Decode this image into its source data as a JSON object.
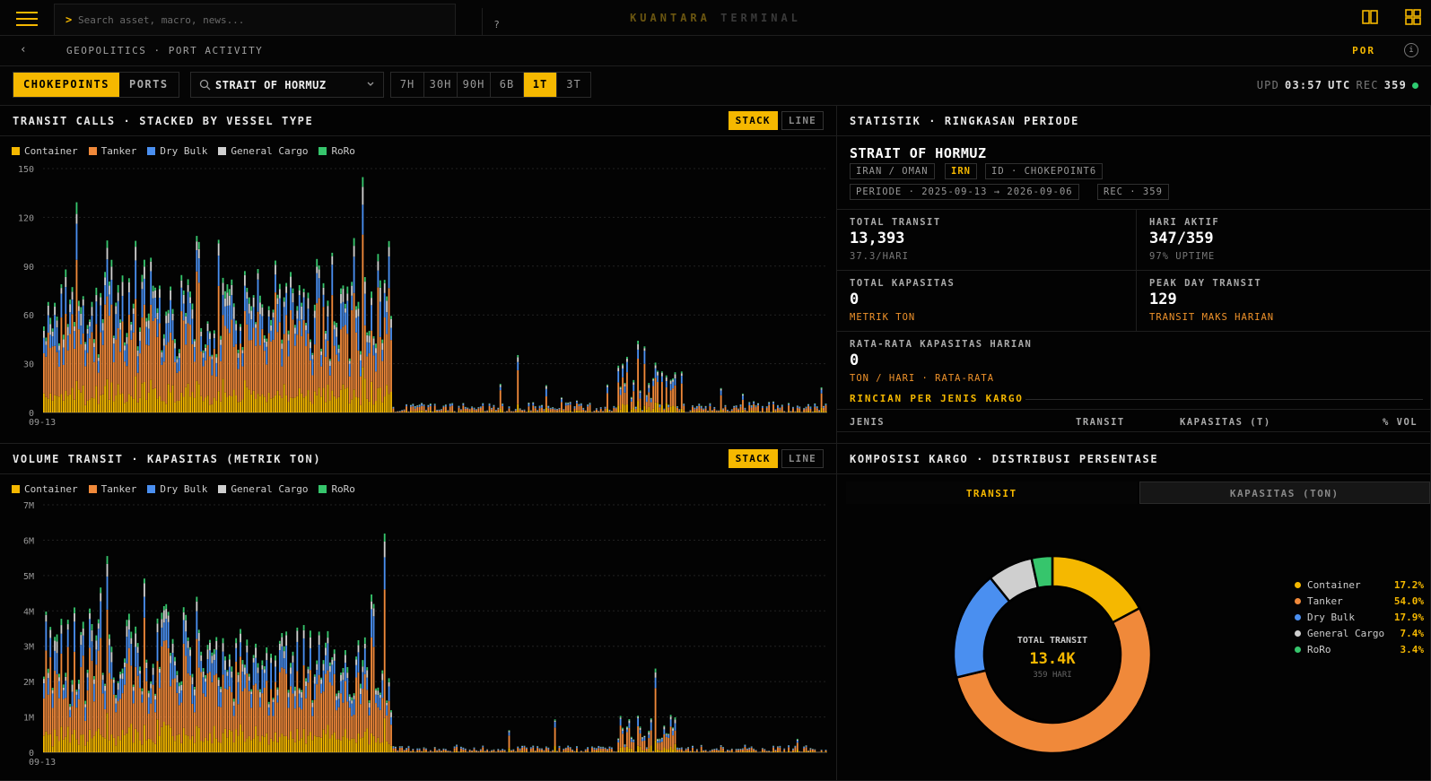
{
  "app": {
    "brand_a": "KUANTARA",
    "brand_b": "TERMINAL",
    "search_placeholder": "Search asset, macro, news...",
    "search_prompt": ">",
    "help": "?"
  },
  "breadcrumb": {
    "text": "GEOPOLITICS · PORT ACTIVITY",
    "back": "‹",
    "lang": "POR",
    "info": "i"
  },
  "toolbar": {
    "tab_chokepoints": "CHOKEPOINTS",
    "tab_ports": "PORTS",
    "selected": "STRAIT OF HORMUZ",
    "ranges": [
      "7H",
      "30H",
      "90H",
      "6B",
      "1T",
      "3T"
    ],
    "active_range": "1T",
    "upd_label": "UPD",
    "upd_time": "03:57",
    "upd_tz": "UTC",
    "rec_label": "REC",
    "rec_count": "359"
  },
  "colors": {
    "accent": "#f5b800",
    "container": "#f5b800",
    "tanker": "#f0893a",
    "drybulk": "#4a8ff0",
    "general": "#cfcfcf",
    "roro": "#36c56c"
  },
  "legend": [
    {
      "name": "Container",
      "color": "#f5b800"
    },
    {
      "name": "Tanker",
      "color": "#f0893a"
    },
    {
      "name": "Dry Bulk",
      "color": "#4a8ff0"
    },
    {
      "name": "General Cargo",
      "color": "#cfcfcf"
    },
    {
      "name": "RoRo",
      "color": "#36c56c"
    }
  ],
  "panel_transit": {
    "title": "TRANSIT CALLS · STACKED BY VESSEL TYPE",
    "stack": "STACK",
    "line": "LINE"
  },
  "panel_volume": {
    "title": "VOLUME TRANSIT · KAPASITAS (METRIK TON)",
    "stack": "STACK",
    "line": "LINE"
  },
  "chart_data": [
    {
      "type": "bar",
      "title": "TRANSIT CALLS · STACKED BY VESSEL TYPE",
      "stacked": true,
      "x_first_label": "09-13",
      "days": 359,
      "yticks": [
        "0",
        "30",
        "60",
        "90",
        "120",
        "150"
      ],
      "ylim": [
        0,
        150
      ],
      "grid": true,
      "series_names": [
        "Container",
        "Tanker",
        "Dry Bulk",
        "General Cargo",
        "RoRo"
      ],
      "profile": [
        {
          "from": 0,
          "to": 160,
          "total": 70,
          "shares": [
            0.17,
            0.54,
            0.18,
            0.07,
            0.04
          ]
        },
        {
          "from": 160,
          "to": 359,
          "total": 5,
          "shares": [
            0.15,
            0.45,
            0.3,
            0.07,
            0.03
          ]
        }
      ],
      "peaks": [
        {
          "day": 15,
          "value": 129
        },
        {
          "day": 146,
          "value": 126
        },
        {
          "day": 272,
          "value": 51
        },
        {
          "day": 217,
          "value": 39
        }
      ]
    },
    {
      "type": "bar",
      "title": "VOLUME TRANSIT · KAPASITAS (METRIK TON)",
      "stacked": true,
      "x_first_label": "09-13",
      "days": 359,
      "yticks": [
        "0",
        "1M",
        "2M",
        "3M",
        "4M",
        "5M",
        "6M",
        "7M"
      ],
      "ylim": [
        0,
        7000000
      ],
      "grid": true,
      "series_names": [
        "Container",
        "Tanker",
        "Dry Bulk",
        "General Cargo",
        "RoRo"
      ],
      "peaks": [
        {
          "day": 29,
          "value": 6200000
        },
        {
          "day": 156,
          "value": 5600000
        },
        {
          "day": 280,
          "value": 2300000
        }
      ]
    },
    {
      "type": "pie",
      "title": "KOMPOSISI KARGO · DISTRIBUSI PERSENTASE",
      "categories": [
        "Container",
        "Tanker",
        "Dry Bulk",
        "General Cargo",
        "RoRo"
      ],
      "values": [
        17.2,
        54.0,
        17.9,
        7.4,
        3.4
      ],
      "center_label": "TOTAL TRANSIT",
      "center_value": "13.4K",
      "center_sub": "359 HARI"
    }
  ],
  "stats": {
    "title": "STATISTIK · RINGKASAN PERIODE",
    "name": "STRAIT OF HORMUZ",
    "chip_country": "IRAN / OMAN",
    "chip_code": "IRN",
    "chip_id": "ID · CHOKEPOINT6",
    "chip_period": "PERIODE · 2025-09-13 → 2026-09-06",
    "chip_rec": "REC · 359",
    "total_transit_label": "TOTAL TRANSIT",
    "total_transit": "13,393",
    "total_transit_sub": "37.3/HARI",
    "hari_aktif_label": "HARI AKTIF",
    "hari_aktif": "347/359",
    "hari_aktif_sub": "97% UPTIME",
    "total_kap_label": "TOTAL KAPASITAS",
    "total_kap": "0",
    "total_kap_sub": "METRIK TON",
    "peak_label": "PEAK DAY TRANSIT",
    "peak": "129",
    "peak_sub": "TRANSIT MAKS HARIAN",
    "avg_label": "RATA-RATA KAPASITAS HARIAN",
    "avg": "0",
    "avg_sub": "TON / HARI · RATA-RATA",
    "breakdown": "RINCIAN PER JENIS KARGO",
    "th_jenis": "JENIS",
    "th_transit": "TRANSIT",
    "th_kap": "KAPASITAS (T)",
    "th_vol": "% VOL"
  },
  "donut": {
    "title": "KOMPOSISI KARGO · DISTRIBUSI PERSENTASE",
    "tab_transit": "TRANSIT",
    "tab_kap": "KAPASITAS (TON)",
    "legend": [
      {
        "name": "Container",
        "pct": "17.2%",
        "color": "#f5b800"
      },
      {
        "name": "Tanker",
        "pct": "54.0%",
        "color": "#f0893a"
      },
      {
        "name": "Dry Bulk",
        "pct": "17.9%",
        "color": "#4a8ff0"
      },
      {
        "name": "General Cargo",
        "pct": "7.4%",
        "color": "#cfcfcf"
      },
      {
        "name": "RoRo",
        "pct": "3.4%",
        "color": "#36c56c"
      }
    ]
  }
}
